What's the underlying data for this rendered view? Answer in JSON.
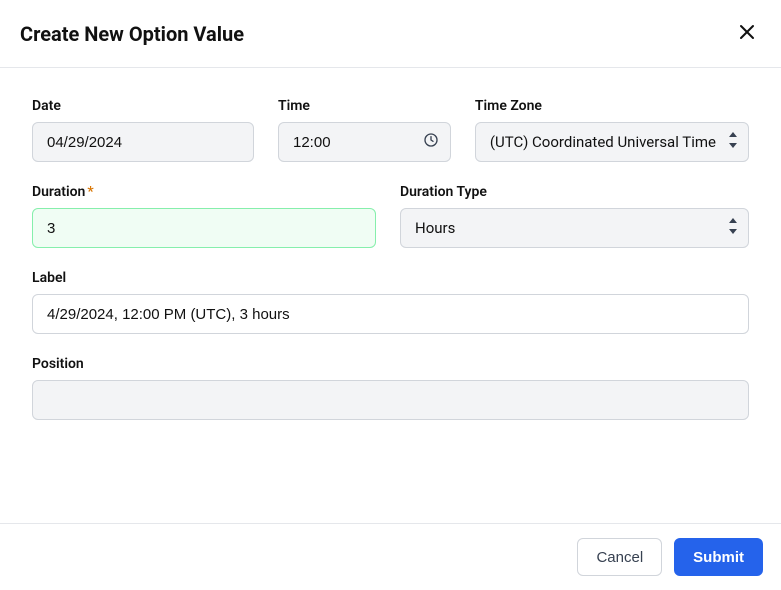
{
  "header": {
    "title": "Create New Option Value"
  },
  "fields": {
    "date": {
      "label": "Date",
      "value": "04/29/2024"
    },
    "time": {
      "label": "Time",
      "value": "12:00"
    },
    "timezone": {
      "label": "Time Zone",
      "value": "(UTC) Coordinated Universal Time"
    },
    "duration": {
      "label": "Duration",
      "value": "3",
      "required": true
    },
    "durationType": {
      "label": "Duration Type",
      "value": "Hours"
    },
    "labelField": {
      "label": "Label",
      "value": "4/29/2024, 12:00 PM (UTC), 3 hours"
    },
    "position": {
      "label": "Position",
      "value": ""
    }
  },
  "footer": {
    "cancel": "Cancel",
    "submit": "Submit"
  }
}
